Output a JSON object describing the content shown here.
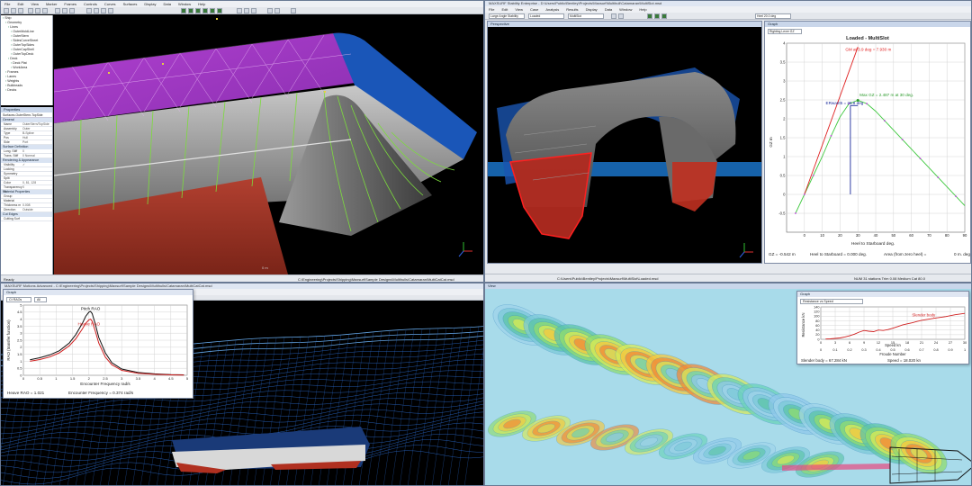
{
  "top_left": {
    "title": "",
    "menu": [
      "File",
      "Edit",
      "View",
      "Marker",
      "Frames",
      "Controls",
      "Curves",
      "Surfaces",
      "Display",
      "Data",
      "Window",
      "Help"
    ],
    "tree_title": "Ship",
    "tree": [
      "Ship",
      "Geometry",
      "Lines",
      "OuterMoldLine",
      "OuterStern",
      "SidesCurveSheet",
      "OuterTopSides",
      "OuterCapShell",
      "OuterTopDeck",
      "Deck",
      "Deck Plat",
      "WorkArea",
      "Frames",
      "Lanes",
      "Weights",
      "Bulkheads",
      "Decks"
    ],
    "props_title": "Properties",
    "props_subtitle": "Surfaces-OuterStern-TopSide",
    "props_sections": [
      {
        "name": "General",
        "rows": [
          [
            "Name",
            "OuterStern/TopSide"
          ],
          [
            "Assembly",
            "Outer"
          ],
          [
            "Type",
            "B-Spline"
          ],
          [
            "Pos",
            "Hull"
          ],
          [
            "Side",
            "Port"
          ]
        ]
      },
      {
        "name": "Surface Definition",
        "rows": [
          [
            "Long. Stiff",
            "0"
          ],
          [
            "Trans. Stiff",
            "0 Normal"
          ]
        ]
      },
      {
        "name": "Rendering & Appearance",
        "rows": [
          [
            "Visibility",
            "✓"
          ],
          [
            "Locking",
            ""
          ],
          [
            "Symmetry",
            ""
          ],
          [
            "Split",
            ""
          ],
          [
            "Color",
            "0, 81, 128"
          ],
          [
            "Transparency %",
            "0"
          ]
        ]
      },
      {
        "name": "Material Properties",
        "rows": [
          [
            "Group",
            ""
          ],
          [
            "Material",
            ""
          ],
          [
            "Thickness m",
            "0.008"
          ],
          [
            "Direction",
            "Outside"
          ]
        ]
      },
      {
        "name": "Cut Edges",
        "rows": [
          [
            "Cutting Surf",
            ""
          ]
        ]
      }
    ],
    "status_left": "Ready",
    "status_right": "C:\\Engineering\\Projects\\Shipping\\Maxsurf\\Sample Designs\\Multihulls\\Catamaran\\MultiCatCat.msd",
    "axis_label": "0 m"
  },
  "top_right": {
    "title": "MAXSURF Stability Enterprise - D:\\Users\\Public\\Bentley\\Projects\\Maxsurf\\Multihull\\Catamaran\\MultiSlot.msd",
    "menu": [
      "File",
      "Edit",
      "View",
      "Case",
      "Analysis",
      "Results",
      "Display",
      "Data",
      "Window",
      "Help"
    ],
    "toolbar_combos": [
      "Large Angle Stability",
      "Loaded",
      "MultiSlot",
      "Heel 20.0 deg"
    ],
    "perspective_title": "Perspective",
    "graph_window_title": "Graph",
    "status_text": "C:\\Users\\Public\\Bentley\\Projects\\Maxsurf\\MultiSlot\\Loaded.msd",
    "status_right": "NUM  31 stations  Trim 0.08 Medium Cat 80.0",
    "graph": {
      "selector": "Righting Lever GZ",
      "title": "Loaded - MultiSlot",
      "ylabel": "GZ  m",
      "xlabel": "Heel to Starboard   deg.",
      "gm_label": "GM at 3.9 deg = 7.930 m",
      "max_gz_label": "Max GZ = 2.487 m at 30 deg.",
      "area_label": "ERwant5 = 25.8 deg",
      "footer": [
        "GZ = -0.542 m",
        "Heel to Starboard = 0.000  deg.",
        "Area (from zero heel) =",
        "0  m. deg"
      ]
    }
  },
  "bottom_left": {
    "title": "MAXSURF Motions Advanced - C:\\Engineering\\Projects\\Shipping\\Maxsurf\\Sample Designs\\Multihulls\\Catamaran\\MultiCatCat.msd",
    "menu": [
      "File",
      "Edit",
      "View",
      "Analysis",
      "Display",
      "Data",
      "Window",
      "Help"
    ],
    "graph_window_title": "Graph",
    "selector_a": "Ct RAOs",
    "selector_b": "All",
    "graph": {
      "ylabel": "RAO (transfer function)",
      "xlabel": "Encounter Frequency  rad/s",
      "pitch_label": "Pitch RAO",
      "heave_label": "Heave RAO",
      "footer": [
        "Heave RAO = 1.021",
        "Encounter Frequency = 0.374 rad/s"
      ]
    }
  },
  "bottom_right": {
    "window_title": "View",
    "graph_window_title": "Graph",
    "selector": "Resistance vs Speed",
    "graph": {
      "ylabel": "Resistance  kN",
      "xlabel_top": "Speed  kn",
      "xlabel_bottom": "Froude Number",
      "series_label": "Slender body",
      "footer": [
        "Slender body = 67.284 kN",
        "Speed = 18.020 kn"
      ]
    }
  },
  "chart_data": [
    {
      "type": "line",
      "title": "Loaded - MultiSlot",
      "xlabel": "Heel to Starboard   deg.",
      "ylabel": "GZ  m",
      "xlim": [
        -10,
        90
      ],
      "ylim": [
        -1,
        4
      ],
      "xticks": [
        0,
        10,
        20,
        30,
        40,
        50,
        60,
        70,
        80,
        90
      ],
      "yticks": [
        -0.5,
        0,
        0.5,
        1,
        1.5,
        2,
        2.5,
        3,
        3.5,
        4
      ],
      "grid": true,
      "series": [
        {
          "name": "GZ",
          "color": "#3ec83e",
          "x": [
            -5,
            0,
            5,
            10,
            15,
            20,
            25,
            30,
            35,
            40,
            45,
            50,
            55,
            60,
            65,
            70,
            75,
            80,
            85,
            90
          ],
          "y": [
            -0.5,
            0.0,
            0.5,
            1.0,
            1.55,
            2.05,
            2.4,
            2.487,
            2.4,
            2.2,
            1.95,
            1.7,
            1.45,
            1.2,
            0.95,
            0.7,
            0.45,
            0.2,
            -0.05,
            -0.3
          ]
        },
        {
          "name": "GM at 3.9 deg = 7.930 m",
          "color": "#e02020",
          "x": [
            0,
            30
          ],
          "y": [
            0,
            3.9
          ]
        }
      ],
      "annotations": [
        {
          "text": "ERwant5 = 25.8 deg",
          "x": 25.8
        },
        {
          "text": "Max GZ = 2.487 m at 30 deg.",
          "x": 30,
          "y": 2.487
        }
      ]
    },
    {
      "type": "line",
      "xlabel": "Encounter Frequency  rad/s",
      "ylabel": "RAO (transfer function)",
      "xlim": [
        0,
        5
      ],
      "ylim": [
        0,
        5
      ],
      "xticks": [
        0,
        0.5,
        1,
        1.5,
        2,
        2.5,
        3,
        3.5,
        4,
        4.5,
        5
      ],
      "yticks": [
        0,
        0.5,
        1,
        1.5,
        2,
        2.5,
        3,
        3.5,
        4,
        4.5,
        5
      ],
      "grid": true,
      "series": [
        {
          "name": "Pitch RAO",
          "color": "#111111",
          "x": [
            0.2,
            0.5,
            0.8,
            1.1,
            1.4,
            1.6,
            1.8,
            1.9,
            2.0,
            2.05,
            2.1,
            2.2,
            2.3,
            2.5,
            2.7,
            3.0,
            3.5,
            4.0,
            4.5,
            4.9
          ],
          "y": [
            1.1,
            1.25,
            1.45,
            1.75,
            2.3,
            2.9,
            3.7,
            4.2,
            4.5,
            4.55,
            4.4,
            3.6,
            2.7,
            1.6,
            0.9,
            0.45,
            0.2,
            0.1,
            0.05,
            0.03
          ]
        },
        {
          "name": "Heave RAO",
          "color": "#d02020",
          "x": [
            0.2,
            0.5,
            0.8,
            1.1,
            1.4,
            1.6,
            1.8,
            1.9,
            2.0,
            2.05,
            2.1,
            2.2,
            2.3,
            2.5,
            2.7,
            3.0,
            3.5,
            4.0,
            4.5,
            4.9
          ],
          "y": [
            1.0,
            1.12,
            1.3,
            1.6,
            2.1,
            2.6,
            3.3,
            3.7,
            3.95,
            4.0,
            3.85,
            3.1,
            2.3,
            1.3,
            0.75,
            0.35,
            0.15,
            0.07,
            0.03,
            0.02
          ]
        }
      ]
    },
    {
      "type": "line",
      "xlabel": "Speed  kn",
      "ylabel": "Resistance  kN",
      "xlim": [
        0,
        30
      ],
      "ylim": [
        0,
        140
      ],
      "xticks": [
        0,
        3,
        6,
        9,
        12,
        15,
        18,
        21,
        24,
        27,
        30
      ],
      "yticks": [
        0,
        20,
        40,
        60,
        80,
        100,
        120,
        140
      ],
      "grid": true,
      "secondary_x": {
        "label": "Froude Number",
        "ticks": [
          0,
          0.1,
          0.2,
          0.3,
          0.4,
          0.5,
          0.6,
          0.7,
          0.8,
          0.9,
          1
        ]
      },
      "series": [
        {
          "name": "Slender body",
          "color": "#d02020",
          "x": [
            1,
            2,
            3,
            4,
            5,
            6,
            7,
            8,
            9,
            10,
            11,
            12,
            13,
            14,
            15,
            16,
            17,
            18,
            19,
            20,
            21,
            22,
            24,
            26,
            28,
            30
          ],
          "y": [
            1,
            2,
            4,
            6,
            10,
            15,
            22,
            31,
            38,
            35,
            33,
            40,
            38,
            42,
            48,
            55,
            62,
            67,
            71,
            77,
            82,
            85,
            92,
            98,
            106,
            112
          ]
        }
      ]
    }
  ]
}
